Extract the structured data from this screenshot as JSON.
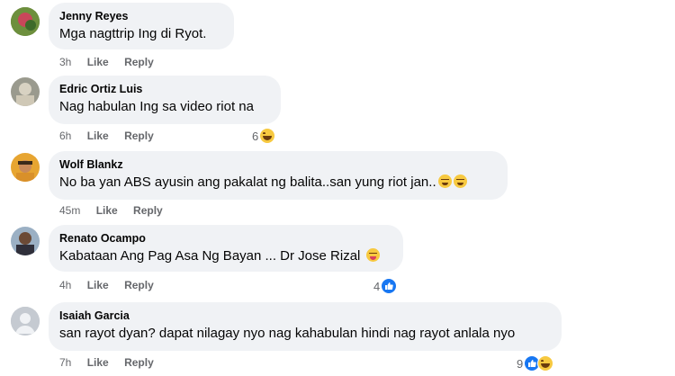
{
  "comments": [
    {
      "name": "Jenny Reyes",
      "text": "Mga nagttrip Ing di Ryot.",
      "time": "3h",
      "like": "Like",
      "reply": "Reply",
      "reaction_count": "",
      "reactions": [],
      "text_emoji": []
    },
    {
      "name": "Edric Ortiz Luis",
      "text": "Nag habulan Ing sa video riot na",
      "time": "6h",
      "like": "Like",
      "reply": "Reply",
      "reaction_count": "6",
      "reactions": [
        "haha"
      ],
      "text_emoji": []
    },
    {
      "name": "Wolf Blankz",
      "text": "No ba yan ABS ayusin ang pakalat ng balita..san yung riot jan..",
      "time": "45m",
      "like": "Like",
      "reply": "Reply",
      "reaction_count": "",
      "reactions": [],
      "text_emoji": [
        "grin",
        "grin"
      ]
    },
    {
      "name": "Renato Ocampo",
      "text": "Kabataan Ang Pag Asa Ng Bayan ... Dr Jose Rizal",
      "time": "4h",
      "like": "Like",
      "reply": "Reply",
      "reaction_count": "4",
      "reactions": [
        "like"
      ],
      "text_emoji": [
        "tongue"
      ]
    },
    {
      "name": "Isaiah Garcia",
      "text": "san rayot dyan? dapat nilagay nyo nag kahabulan hindi nag rayot anlala nyo",
      "time": "7h",
      "like": "Like",
      "reply": "Reply",
      "reaction_count": "9",
      "reactions": [
        "like",
        "haha"
      ],
      "text_emoji": []
    }
  ],
  "colors": {
    "bubble": "#f0f2f5",
    "meta": "#65676b",
    "like_blue": "#1877f2",
    "haha_yellow": "#f7c940"
  }
}
